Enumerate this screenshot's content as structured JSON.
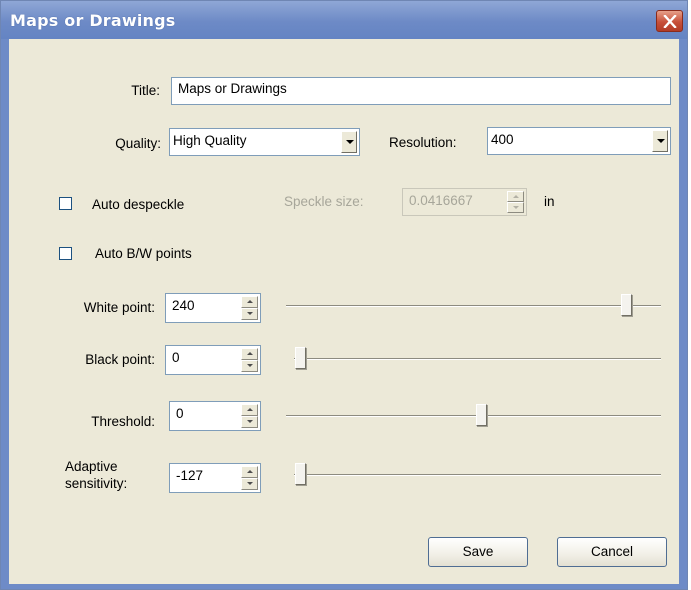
{
  "window": {
    "title": "Maps or Drawings",
    "close_icon": "close-icon",
    "title_bar_color": "#6d8ac6",
    "client_color": "#ece9d8"
  },
  "form": {
    "title_label": "Title:",
    "title_value": "Maps or Drawings",
    "quality_label": "Quality:",
    "quality_value": "High Quality",
    "resolution_label": "Resolution:",
    "resolution_value": "400",
    "auto_despeckle_label": "Auto despeckle",
    "auto_despeckle_checked": false,
    "speckle_size_label": "Speckle size:",
    "speckle_size_value": "0.0416667",
    "speckle_unit": "in",
    "auto_bw_label": "Auto B/W points",
    "auto_bw_checked": false,
    "white_point_label": "White point:",
    "white_point_value": "240",
    "black_point_label": "Black point:",
    "black_point_value": "0",
    "threshold_label": "Threshold:",
    "threshold_value": "0",
    "adaptive_label_line1": "Adaptive",
    "adaptive_label_line2": "sensitivity:",
    "adaptive_value": "-127"
  },
  "sliders": {
    "white_point_level": 0.92,
    "black_point_level": 0.0,
    "threshold_level": 0.52,
    "adaptive_level": 0.0
  },
  "buttons": {
    "save_label": "Save",
    "cancel_label": "Cancel"
  }
}
